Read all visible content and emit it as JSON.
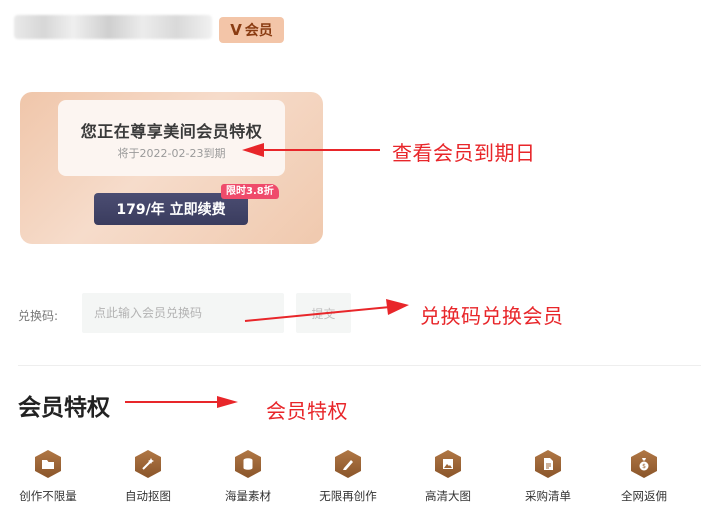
{
  "user": {
    "vip_badge": {
      "letter": "V",
      "label": "会员"
    }
  },
  "member_card": {
    "title": "您正在尊享美间会员特权",
    "expiry_text": "将于2022-02-23到期",
    "renew_button": "179/年 立即续费",
    "discount_tag": "限时3.8折"
  },
  "annotations": {
    "expiry": "查看会员到期日",
    "redeem": "兑换码兑换会员",
    "privileges": "会员特权"
  },
  "redeem": {
    "label": "兑换码:",
    "placeholder": "点此输入会员兑换码",
    "submit_label": "提交"
  },
  "privileges": {
    "title": "会员特权",
    "items": [
      {
        "label": "创作不限量",
        "icon": "folder-icon"
      },
      {
        "label": "自动抠图",
        "icon": "magic-wand-icon"
      },
      {
        "label": "海量素材",
        "icon": "cylinder-icon"
      },
      {
        "label": "无限再创作",
        "icon": "pencil-icon"
      },
      {
        "label": "高清大图",
        "icon": "image-icon"
      },
      {
        "label": "采购清单",
        "icon": "document-icon"
      },
      {
        "label": "全网返佣",
        "icon": "money-bag-icon"
      }
    ]
  },
  "colors": {
    "accent_red": "#e8262a",
    "badge_bg": "#f3c5a8",
    "card_bg": "#f0c6aa",
    "button_dark": "#3f4165",
    "icon_brown": "#9c6536",
    "discount_pink": "#ef4b6b"
  }
}
